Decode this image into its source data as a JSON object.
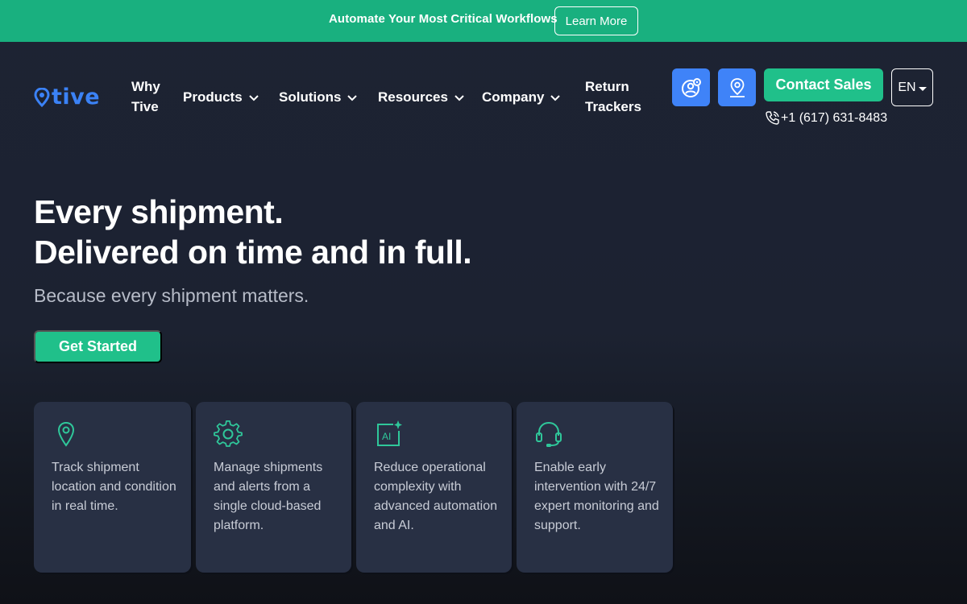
{
  "banner": {
    "text": "Automate Your Most Critical Workflows",
    "button": "Learn More"
  },
  "nav": {
    "logo_text": "tive",
    "items": [
      {
        "label_line1": "Why",
        "label_line2": "Tive"
      },
      {
        "label": "Products"
      },
      {
        "label": "Solutions"
      },
      {
        "label": "Resources"
      },
      {
        "label": "Company"
      },
      {
        "label_line1": "Return",
        "label_line2": "Trackers"
      }
    ],
    "contact_sales": "Contact Sales",
    "language": "EN",
    "phone": "+1 (617) 631-8483",
    "icons": [
      "user-support-icon",
      "location-pin-icon",
      "phone-icon",
      "chevron-down-icon"
    ]
  },
  "hero": {
    "title_line1": "Every shipment.",
    "title_line2": "Delivered on time and in full.",
    "subtitle": "Because every shipment matters.",
    "cta": "Get Started"
  },
  "features": [
    {
      "icon": "location-pin-icon",
      "text": "Track shipment location and condition in real time."
    },
    {
      "icon": "gear-icon",
      "text": "Manage shipments and alerts from a single cloud-based platform."
    },
    {
      "icon": "ai-sparkle-icon",
      "text": "Reduce operational complexity with advanced automation and AI."
    },
    {
      "icon": "headset-icon",
      "text": "Enable early intervention with 24/7 expert monitoring and support."
    }
  ],
  "colors": {
    "banner": "#19b07f",
    "accent_green": "#20c08a",
    "accent_blue": "#3f83f8",
    "background": "#1d2333",
    "card": "#283044",
    "feature_icon": "#2fc79a"
  }
}
